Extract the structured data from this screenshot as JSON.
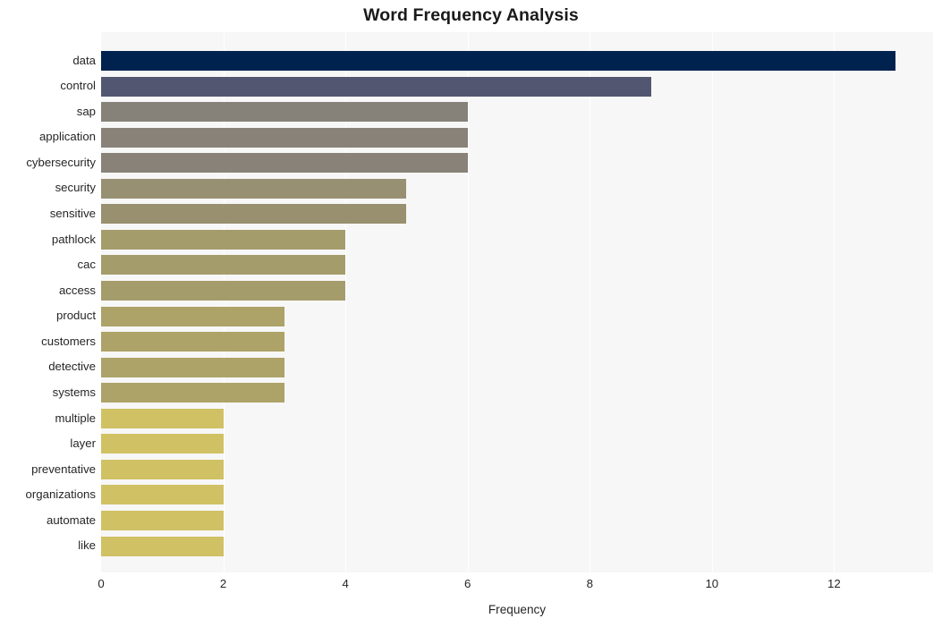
{
  "chart_data": {
    "type": "bar",
    "orientation": "horizontal",
    "title": "Word Frequency Analysis",
    "xlabel": "Frequency",
    "ylabel": "",
    "categories": [
      "data",
      "control",
      "sap",
      "application",
      "cybersecurity",
      "security",
      "sensitive",
      "pathlock",
      "cac",
      "access",
      "product",
      "customers",
      "detective",
      "systems",
      "multiple",
      "layer",
      "preventative",
      "organizations",
      "automate",
      "like"
    ],
    "values": [
      13,
      9,
      6,
      6,
      6,
      5,
      5,
      4,
      4,
      4,
      3,
      3,
      3,
      3,
      2,
      2,
      2,
      2,
      2,
      2
    ],
    "bar_colors": [
      "#00224e",
      "#525670",
      "#878279",
      "#888279",
      "#888279",
      "#989073",
      "#98906f",
      "#a59c6c",
      "#a59c6c",
      "#a59c6c",
      "#ada368",
      "#ada368",
      "#ada368",
      "#ada368",
      "#d0c164",
      "#d0c164",
      "#d0c164",
      "#d0c164",
      "#d0c164",
      "#d0c164"
    ],
    "colormap": "cividis",
    "xlim": [
      0,
      13.62
    ],
    "xticks": [
      0,
      2,
      4,
      6,
      8,
      10,
      12
    ],
    "xtick_labels": [
      "0",
      "2",
      "4",
      "6",
      "8",
      "10",
      "12"
    ],
    "grid": true,
    "grid_axis": "x",
    "legend": false,
    "plot_background": "#f7f7f7",
    "figure_background": "#ffffff",
    "gridline_color": "#ffffff",
    "title_color": "#1a1a1a",
    "tick_label_color": "#262626"
  }
}
